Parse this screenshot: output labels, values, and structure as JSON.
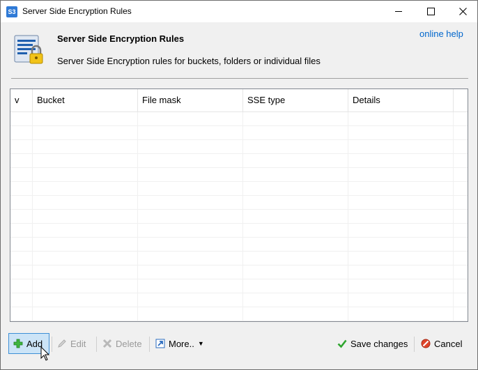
{
  "window": {
    "title": "Server Side Encryption Rules",
    "app_icon_text": "S3"
  },
  "header": {
    "title": "Server Side Encryption Rules",
    "subtitle": "Server Side Encryption rules for buckets, folders or individual files",
    "help_link": "online help"
  },
  "list": {
    "columns": [
      "v",
      "Bucket",
      "File mask",
      "SSE type",
      "Details"
    ],
    "rows": []
  },
  "toolbar": {
    "add_label": "Add",
    "edit_label": "Edit",
    "delete_label": "Delete",
    "more_label": "More..",
    "save_label": "Save changes",
    "cancel_label": "Cancel"
  },
  "colors": {
    "link": "#0066cc",
    "add_selected_bg": "#cce4f7",
    "add_selected_border": "#3d8fd6",
    "disabled_text": "#9a9a9a"
  }
}
